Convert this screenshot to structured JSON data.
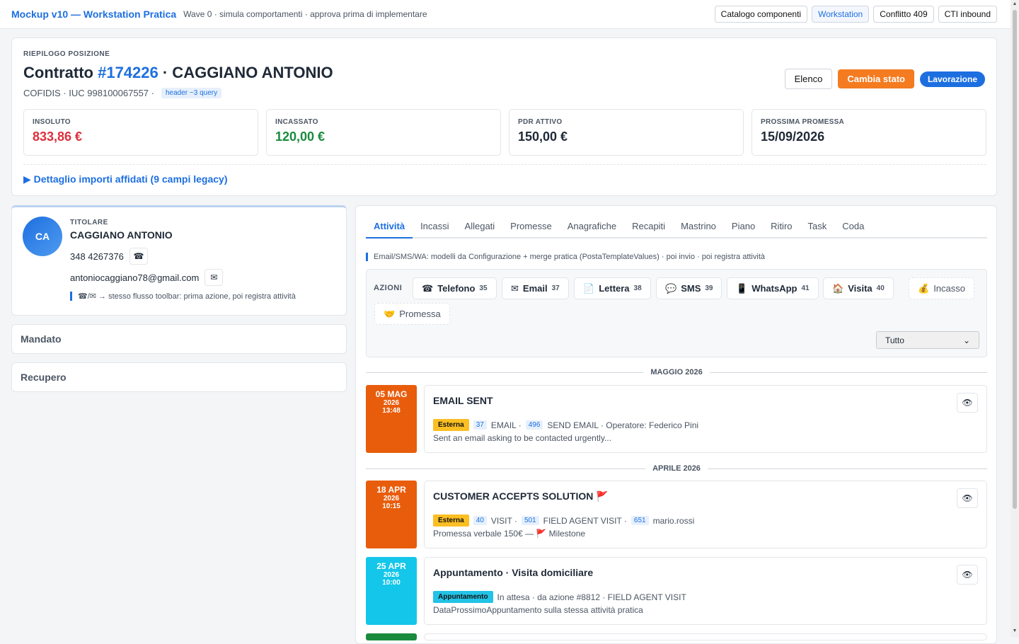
{
  "topbar": {
    "brand": "Mockup v10 — Workstation Pratica",
    "subtitle": "Wave 0 · simula comportamenti · approva prima di implementare",
    "nav": [
      "Catalogo componenti",
      "Workstation",
      "Conflitto 409",
      "CTI inbound"
    ],
    "active_nav": "Workstation"
  },
  "summary": {
    "eyebrow": "RIEPILOGO POSIZIONE",
    "title_prefix": "Contratto ",
    "contract_number": "#174226",
    "title_suffix": " · CAGGIANO ANTONIO",
    "meta": "COFIDIS · IUC 998100067557 ·",
    "meta_chip": "header ~3 query",
    "btn_list": "Elenco",
    "btn_change_state": "Cambia stato",
    "state_pill": "Lavorazione",
    "kpis": [
      {
        "label": "INSOLUTO",
        "value": "833,86 €",
        "color": "#dc2f3c"
      },
      {
        "label": "INCASSATO",
        "value": "120,00 €",
        "color": "#1a8a3c"
      },
      {
        "label": "PDR ATTIVO",
        "value": "150,00 €",
        "color": "#1f2937"
      },
      {
        "label": "PROSSIMA PROMESSA",
        "value": "15/09/2026",
        "color": "#1f2937"
      }
    ],
    "detail_link": "▶  Dettaglio importi affidati (9 campi legacy)"
  },
  "owner": {
    "eyebrow": "TITOLARE",
    "initials": "CA",
    "name": "CAGGIANO ANTONIO",
    "phone": "348 4267376",
    "email": "antoniocaggiano78@gmail.com",
    "note": "☎/✉ → stesso flusso toolbar: prima azione, poi registra attività"
  },
  "accordions": [
    "Mandato",
    "Recupero"
  ],
  "tabs": [
    "Attività",
    "Incassi",
    "Allegati",
    "Promesse",
    "Anagrafiche",
    "Recapiti",
    "Mastrino",
    "Piano",
    "Ritiro",
    "Task",
    "Coda"
  ],
  "active_tab": "Attività",
  "info": "Email/SMS/WA: modelli da Configurazione + merge pratica (PostaTemplateValues) · poi invio · poi registra attività",
  "actions": {
    "label": "AZIONI",
    "buttons": [
      {
        "icon": "☎",
        "label": "Telefono",
        "count": "35"
      },
      {
        "icon": "✉",
        "label": "Email",
        "count": "37"
      },
      {
        "icon": "📄",
        "label": "Lettera",
        "count": "38"
      },
      {
        "icon": "💬",
        "label": "SMS",
        "count": "39"
      },
      {
        "icon": "📱",
        "label": "WhatsApp",
        "count": "41"
      },
      {
        "icon": "🏠",
        "label": "Visita",
        "count": "40"
      }
    ],
    "ghost": [
      {
        "icon": "💰",
        "label": "Incasso"
      },
      {
        "icon": "🤝",
        "label": "Promessa"
      }
    ],
    "filter": "Tutto"
  },
  "timeline": {
    "months": [
      "MAGGIO 2026",
      "APRILE 2026"
    ],
    "items": [
      {
        "day": "05 MAG",
        "year": "2026",
        "time": "13:48",
        "color": "#e85d0c",
        "title": "EMAIL SENT",
        "badge": "Esterna",
        "c1": "37",
        "t1": "EMAIL ·",
        "c2": "496",
        "t2": "SEND EMAIL · Operatore: Federico Pini",
        "c3": "",
        "t3": "",
        "summary": "Sent an email asking to be contacted urgently..."
      },
      {
        "day": "18 APR",
        "year": "2026",
        "time": "10:15",
        "color": "#e85d0c",
        "title": "CUSTOMER ACCEPTS SOLUTION 🚩",
        "badge": "Esterna",
        "c1": "40",
        "t1": "VISIT ·",
        "c2": "501",
        "t2": "FIELD AGENT VISIT ·",
        "c3": "651",
        "t3": "mario.rossi",
        "summary": "Promessa verbale 150€ — 🚩 Milestone"
      },
      {
        "day": "25 APR",
        "year": "2026",
        "time": "10:00",
        "color": "#14c6ea",
        "title": "Appuntamento · Visita domiciliare",
        "badge": "Appuntamento",
        "c1": "",
        "t1": "In attesa · da azione #8812 · FIELD AGENT VISIT",
        "c2": "",
        "t2": "",
        "c3": "",
        "t3": "",
        "summary": "DataProssimoAppuntamento sulla stessa attività pratica"
      }
    ]
  }
}
